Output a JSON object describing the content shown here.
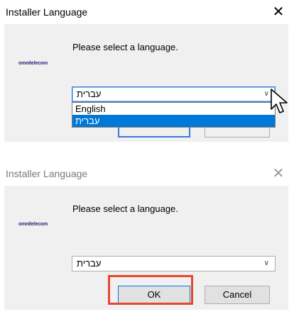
{
  "dialog1": {
    "title": "Installer Language",
    "close": "✕",
    "logo": "omnitelecom",
    "prompt": "Please select a language.",
    "selected": "עברית",
    "options": [
      "English",
      "עברית"
    ]
  },
  "dialog2": {
    "title": "Installer Language",
    "close": "✕",
    "logo": "omnitelecom",
    "prompt": "Please select a language.",
    "selected": "עברית",
    "ok_label": "OK",
    "cancel_label": "Cancel"
  },
  "colors": {
    "selection": "#0078d7",
    "highlight_box": "#e8472f"
  }
}
